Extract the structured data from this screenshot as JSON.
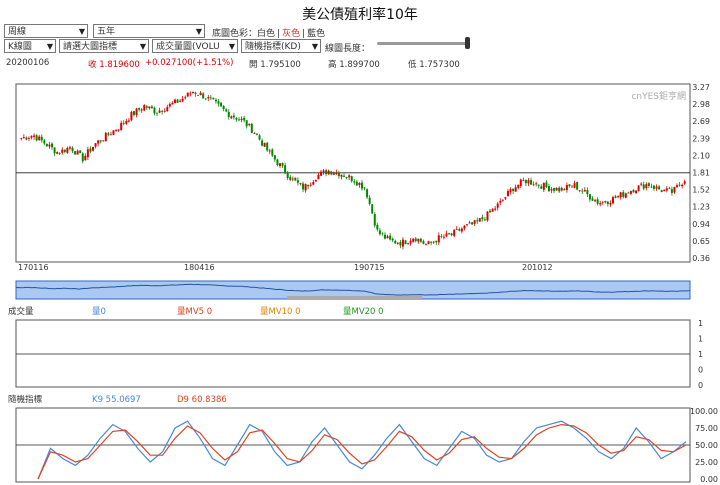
{
  "title": "美公債殖利率10年",
  "controls": {
    "period": "周線",
    "range": "五年",
    "chart_type": "K線圖",
    "overlay": "請選大圖指標",
    "volume": "成交量圖(VOLU",
    "indicator": "隨機指標(KD)",
    "bg_label": "底圖色彩：",
    "bg_white": "白色",
    "bg_gray": "灰色",
    "bg_blue": "藍色",
    "sep1": "|",
    "sep2": "|",
    "length_label": "線圖長度："
  },
  "colors": {
    "up": "#dd0000",
    "down": "#008800",
    "accent": "#2255cc",
    "k_line": "#4488dd",
    "d_line": "#dd4422"
  },
  "quote": {
    "date": "20200106",
    "close_label": "收",
    "close": "1.819600",
    "change": "+0.027100(+1.51%)",
    "open_label": "開",
    "open": "1.795100",
    "high_label": "高",
    "high": "1.899700",
    "low_label": "低",
    "low": "1.757300"
  },
  "watermark": "cnYES鉅亨網",
  "volume_legend": {
    "title": "成交量",
    "v": "量0",
    "mv5": "量MV5 0",
    "mv10": "量MV10 0",
    "mv20": "量MV20 0"
  },
  "kd_legend": {
    "title": "隨機指標",
    "k": "K9 55.0697",
    "d": "D9 60.8386"
  },
  "chart_data": [
    {
      "type": "candlestick",
      "ylim": [
        0.36,
        3.27
      ],
      "yticks": [
        "3.27",
        "2.98",
        "2.69",
        "2.39",
        "2.10",
        "1.81",
        "1.52",
        "1.23",
        "0.94",
        "0.65",
        "0.36"
      ],
      "xticks": [
        "170116",
        "180416",
        "190715",
        "201012"
      ],
      "reference_line": 1.81,
      "close_anchors": [
        2.4,
        2.45,
        2.3,
        2.15,
        2.25,
        2.05,
        2.3,
        2.45,
        2.6,
        2.8,
        2.95,
        2.85,
        2.95,
        3.05,
        3.2,
        3.1,
        2.95,
        2.8,
        2.7,
        2.5,
        2.2,
        1.95,
        1.7,
        1.55,
        1.75,
        1.85,
        1.8,
        1.7,
        1.55,
        0.8,
        0.65,
        0.62,
        0.72,
        0.58,
        0.7,
        0.75,
        0.88,
        0.95,
        1.1,
        1.3,
        1.55,
        1.68,
        1.62,
        1.55,
        1.52,
        1.6,
        1.45,
        1.3,
        1.35,
        1.45,
        1.55,
        1.62,
        1.52,
        1.48,
        1.7
      ]
    },
    {
      "type": "bar",
      "series": [
        {
          "values": [
            0
          ]
        }
      ],
      "yticks": [
        "1",
        "1",
        "1",
        "0",
        "0"
      ]
    },
    {
      "type": "line",
      "ylim": [
        0,
        100
      ],
      "yticks": [
        "100.00",
        "75.00",
        "50.00",
        "25.00",
        "0.00"
      ],
      "series": [
        {
          "name": "K9",
          "values": [
            0,
            45,
            30,
            20,
            35,
            60,
            80,
            70,
            45,
            25,
            40,
            75,
            85,
            60,
            30,
            20,
            50,
            80,
            70,
            40,
            20,
            25,
            55,
            75,
            50,
            25,
            15,
            35,
            60,
            80,
            55,
            30,
            20,
            45,
            70,
            60,
            35,
            25,
            30,
            55,
            75,
            80,
            85,
            75,
            60,
            40,
            30,
            45,
            75,
            55,
            30,
            40,
            55
          ]
        },
        {
          "name": "D9",
          "values": [
            0,
            40,
            35,
            25,
            30,
            50,
            70,
            72,
            55,
            35,
            35,
            60,
            78,
            68,
            45,
            28,
            40,
            68,
            72,
            52,
            30,
            25,
            42,
            65,
            58,
            38,
            22,
            28,
            48,
            70,
            62,
            42,
            28,
            38,
            58,
            62,
            45,
            32,
            30,
            45,
            65,
            75,
            80,
            78,
            68,
            50,
            38,
            42,
            62,
            58,
            42,
            40,
            50
          ]
        }
      ]
    }
  ]
}
